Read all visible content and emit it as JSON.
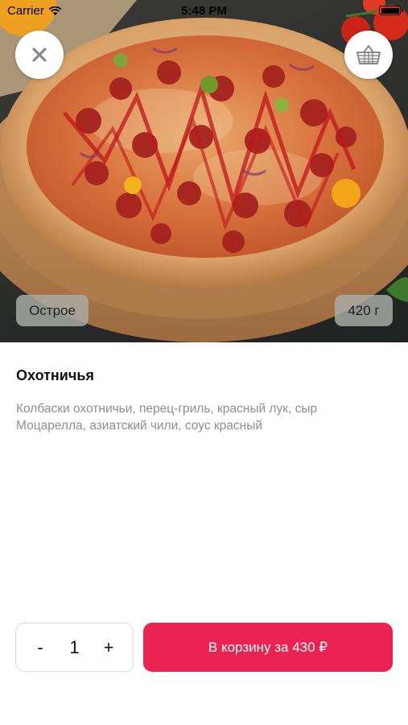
{
  "status_bar": {
    "carrier": "Carrier",
    "time": "5:48 PM"
  },
  "product": {
    "tag": "Острое",
    "weight": "420 г",
    "title": "Охотничья",
    "description": "Колбаски охотничьи, перец-гриль, красный лук, сыр Моцарелла, азиатский чили, соус красный"
  },
  "controls": {
    "minus": "-",
    "quantity": "1",
    "plus": "+",
    "add_to_cart": "В корзину за 430 ₽"
  },
  "icons": {
    "close": "close-icon",
    "basket": "basket-icon",
    "wifi": "wifi-icon",
    "battery": "battery-icon"
  },
  "colors": {
    "accent": "#ea2352",
    "badge_bg": "#aaafa8",
    "description_text": "#8e8e93"
  }
}
